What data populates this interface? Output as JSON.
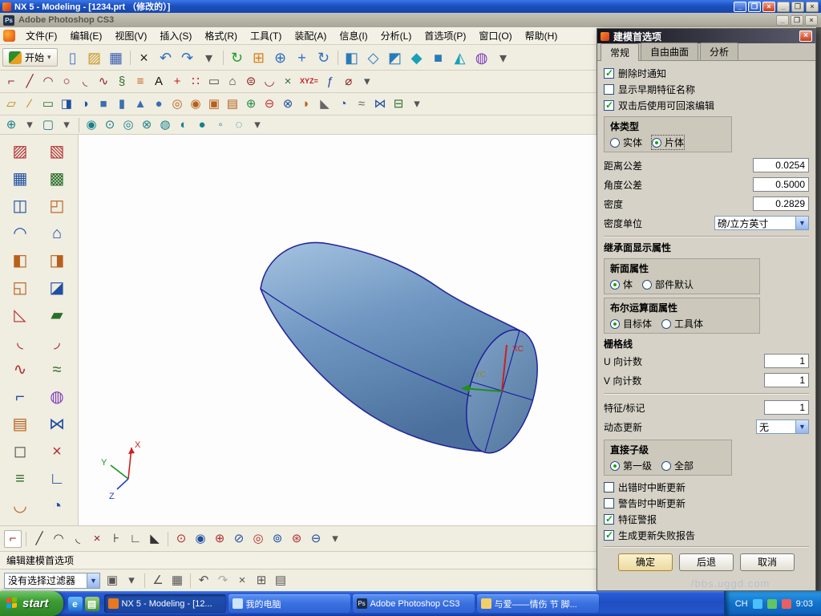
{
  "titlebar": {
    "title": "NX 5 - Modeling - [1234.prt （修改的）]"
  },
  "photoshop": {
    "title": "Adobe Photoshop CS3"
  },
  "menu": [
    "文件(F)",
    "编辑(E)",
    "视图(V)",
    "插入(S)",
    "格式(R)",
    "工具(T)",
    "装配(A)",
    "信息(I)",
    "分析(L)",
    "首选项(P)",
    "窗口(O)",
    "帮助(H)"
  ],
  "start_button": {
    "label": "开始",
    "arrow": "▾"
  },
  "icons": {
    "row1": [
      {
        "name": "new-part-icon",
        "glyph": "▯",
        "color": "#4a76c8"
      },
      {
        "name": "open-icon",
        "glyph": "▨",
        "color": "#c8982a"
      },
      {
        "name": "save-icon",
        "glyph": "▦",
        "color": "#3a5fae"
      },
      {
        "sep": true
      },
      {
        "name": "delete-icon",
        "glyph": "×",
        "color": "#222222"
      },
      {
        "name": "undo-icon",
        "glyph": "↶",
        "color": "#2d6fc2"
      },
      {
        "name": "redo-icon",
        "glyph": "↷",
        "color": "#2d6fc2"
      },
      {
        "name": "dropdown-icon",
        "glyph": "▾",
        "color": "#555555"
      },
      {
        "sep": true
      },
      {
        "name": "refresh-icon",
        "glyph": "↻",
        "color": "#1f9d2f"
      },
      {
        "name": "fit-view-icon",
        "glyph": "⊞",
        "color": "#d9821e"
      },
      {
        "name": "zoom-icon",
        "glyph": "⊕",
        "color": "#2d6fc2"
      },
      {
        "name": "pan-icon",
        "glyph": "+",
        "color": "#2d6fc2"
      },
      {
        "name": "rotate-view-icon",
        "glyph": "↻",
        "color": "#2d6fc2"
      },
      {
        "sep": true
      },
      {
        "name": "shaded-view-icon",
        "glyph": "◧",
        "color": "#2a7ab8"
      },
      {
        "name": "wireframe-view-icon",
        "glyph": "◇",
        "color": "#2a7ab8"
      },
      {
        "name": "trimetric-view-icon",
        "glyph": "◩",
        "color": "#2a7ab8"
      },
      {
        "name": "isometric-view-icon",
        "glyph": "◆",
        "color": "#18a0b8"
      },
      {
        "name": "front-view-icon",
        "glyph": "■",
        "color": "#2a7ab8"
      },
      {
        "name": "orient-view-icon",
        "glyph": "◭",
        "color": "#18a0b8"
      },
      {
        "name": "display-mode-icon",
        "glyph": "◍",
        "color": "#7a3ab8"
      },
      {
        "name": "dropdown-icon",
        "glyph": "▾",
        "color": "#555555"
      }
    ],
    "row2": [
      {
        "name": "profile-icon",
        "glyph": "⌐",
        "color": "#8a1f1f"
      },
      {
        "name": "line-icon",
        "glyph": "╱",
        "color": "#8a1f1f"
      },
      {
        "name": "arc-icon",
        "glyph": "◠",
        "color": "#8a1f1f"
      },
      {
        "name": "circle-icon",
        "glyph": "○",
        "color": "#8a1f1f"
      },
      {
        "name": "fillet-curve-icon",
        "glyph": "◟",
        "color": "#8a1f1f"
      },
      {
        "name": "spline-icon",
        "glyph": "∿",
        "color": "#8a1f1f"
      },
      {
        "name": "helix-icon",
        "glyph": "§",
        "color": "#2a6f2a"
      },
      {
        "name": "offset-curve-icon",
        "glyph": "≡",
        "color": "#c2641e"
      },
      {
        "name": "text-icon",
        "glyph": "A",
        "color": "#111111"
      },
      {
        "name": "point-icon",
        "glyph": "+",
        "color": "#c02020"
      },
      {
        "name": "point-set-icon",
        "glyph": "∷",
        "color": "#c02020"
      },
      {
        "name": "rectangle-icon",
        "glyph": "▭",
        "color": "#444444"
      },
      {
        "name": "polygon-icon",
        "glyph": "⌂",
        "color": "#444444"
      },
      {
        "name": "ellipse-icon",
        "glyph": "⊜",
        "color": "#8a1f1f"
      },
      {
        "name": "conic-icon",
        "glyph": "◡",
        "color": "#8a1f1f"
      },
      {
        "name": "intersection-point-icon",
        "glyph": "×",
        "color": "#2a6f2a"
      },
      {
        "name": "coordinates-icon",
        "glyph": "XYZ=",
        "color": "#c02020",
        "wide": true
      },
      {
        "name": "law-curve-icon",
        "glyph": "ƒ",
        "color": "#1f4fa0"
      },
      {
        "name": "group-curve-icon",
        "glyph": "⌀",
        "color": "#8a1f1f"
      },
      {
        "name": "dropdown-icon",
        "glyph": "▾",
        "color": "#555555"
      }
    ],
    "row3": [
      {
        "name": "datum-plane-icon",
        "glyph": "▱",
        "color": "#b8860b"
      },
      {
        "name": "datum-axis-icon",
        "glyph": "∕",
        "color": "#b8860b"
      },
      {
        "name": "sketch-icon",
        "glyph": "▭",
        "color": "#2a6f2a"
      },
      {
        "name": "extrude-icon",
        "glyph": "◨",
        "color": "#1f4fa0"
      },
      {
        "name": "revolve-icon",
        "glyph": "◑",
        "color": "#1f4fa0"
      },
      {
        "name": "block-icon",
        "glyph": "■",
        "color": "#3a6fb0"
      },
      {
        "name": "cylinder-icon",
        "glyph": "▮",
        "color": "#3a6fb0"
      },
      {
        "name": "cone-icon",
        "glyph": "▲",
        "color": "#3a6fb0"
      },
      {
        "name": "sphere-primitive-icon",
        "glyph": "●",
        "color": "#3a6fb0"
      },
      {
        "name": "hole-icon",
        "glyph": "◎",
        "color": "#b8601a"
      },
      {
        "name": "boss-icon",
        "glyph": "◉",
        "color": "#b8601a"
      },
      {
        "name": "pocket-icon",
        "glyph": "▣",
        "color": "#b8601a"
      },
      {
        "name": "pad-icon",
        "glyph": "▤",
        "color": "#b8601a"
      },
      {
        "name": "unite-icon",
        "glyph": "⊕",
        "color": "#1f8f3f"
      },
      {
        "name": "subtract-icon",
        "glyph": "⊖",
        "color": "#c03030"
      },
      {
        "name": "intersect-icon",
        "glyph": "⊗",
        "color": "#1f4fa0"
      },
      {
        "name": "edge-blend-icon",
        "glyph": "◗",
        "color": "#b8601a"
      },
      {
        "name": "chamfer-icon",
        "glyph": "◣",
        "color": "#666666"
      },
      {
        "name": "shell-icon",
        "glyph": "◔",
        "color": "#1f4fa0"
      },
      {
        "name": "thread-icon",
        "glyph": "≈",
        "color": "#666666"
      },
      {
        "name": "sew-icon",
        "glyph": "⋈",
        "color": "#1f4fa0"
      },
      {
        "name": "thicken-icon",
        "glyph": "⊟",
        "color": "#2a6f2a"
      },
      {
        "name": "dropdown-icon",
        "glyph": "▾",
        "color": "#555555"
      }
    ],
    "row4": [
      {
        "name": "point-dialog-icon",
        "glyph": "⊕",
        "color": "#18808a"
      },
      {
        "name": "dropdown-icon",
        "glyph": "▾",
        "color": "#555555"
      },
      {
        "name": "plane-dialog-icon",
        "glyph": "▢",
        "color": "#18808a"
      },
      {
        "name": "dropdown-icon",
        "glyph": "▾",
        "color": "#555555"
      },
      {
        "sep": true
      },
      {
        "name": "snap-endpoint-icon",
        "glyph": "◉",
        "color": "#18808a"
      },
      {
        "name": "snap-midpoint-icon",
        "glyph": "⊙",
        "color": "#18808a"
      },
      {
        "name": "snap-control-point-icon",
        "glyph": "◎",
        "color": "#18808a"
      },
      {
        "name": "snap-intersection-icon",
        "glyph": "⊗",
        "color": "#18808a"
      },
      {
        "name": "snap-center-icon",
        "glyph": "◍",
        "color": "#18808a"
      },
      {
        "name": "snap-quadrant-icon",
        "glyph": "◐",
        "color": "#18808a"
      },
      {
        "name": "snap-existing-point-icon",
        "glyph": "●",
        "color": "#18808a"
      },
      {
        "name": "snap-point-on-curve-icon",
        "glyph": "◦",
        "color": "#18808a"
      },
      {
        "name": "snap-point-on-surface-icon",
        "glyph": "◌",
        "color": "#18808a"
      },
      {
        "name": "dropdown-icon",
        "glyph": "▾",
        "color": "#555555"
      }
    ],
    "sidebar": [
      {
        "name": "through-points-icon",
        "glyph": "▨",
        "color": "#b03030"
      },
      {
        "name": "ruled-surface-icon",
        "glyph": "▧",
        "color": "#b03030"
      },
      {
        "name": "through-curves-icon",
        "glyph": "▦",
        "color": "#1f4fa0"
      },
      {
        "name": "through-curve-mesh-icon",
        "glyph": "▩",
        "color": "#2a6f2a"
      },
      {
        "name": "swept-surface-icon",
        "glyph": "◫",
        "color": "#1f4fa0"
      },
      {
        "name": "section-surface-icon",
        "glyph": "◰",
        "color": "#b8601a"
      },
      {
        "name": "bridge-surface-icon",
        "glyph": "◠",
        "color": "#1f4fa0"
      },
      {
        "name": "n-sided-surface-icon",
        "glyph": "⌂",
        "color": "#1f4fa0"
      },
      {
        "name": "extension-surface-icon",
        "glyph": "◧",
        "color": "#b8601a"
      },
      {
        "name": "law-extension-icon",
        "glyph": "◨",
        "color": "#b8601a"
      },
      {
        "name": "enlarge-surface-icon",
        "glyph": "◱",
        "color": "#b8601a"
      },
      {
        "name": "offset-surface-icon",
        "glyph": "◪",
        "color": "#1f4fa0"
      },
      {
        "name": "trimmed-sheet-icon",
        "glyph": "◺",
        "color": "#b03030"
      },
      {
        "name": "bounded-plane-icon",
        "glyph": "▰",
        "color": "#2a6f2a"
      },
      {
        "name": "fillet-surface-icon",
        "glyph": "◟",
        "color": "#b03030"
      },
      {
        "name": "face-blend-icon",
        "glyph": "◞",
        "color": "#b03030"
      },
      {
        "name": "soft-blend-icon",
        "glyph": "∿",
        "color": "#b03030"
      },
      {
        "name": "styled-blend-icon",
        "glyph": "≈",
        "color": "#2a6f2a"
      },
      {
        "name": "silhouette-flange-icon",
        "glyph": "⌐",
        "color": "#1f4fa0"
      },
      {
        "name": "global-shaping-icon",
        "glyph": "◍",
        "color": "#7a3ab8"
      },
      {
        "name": "quilt-surface-icon",
        "glyph": "▤",
        "color": "#b8601a"
      },
      {
        "name": "sew-surface-icon",
        "glyph": "⋈",
        "color": "#1f4fa0"
      },
      {
        "name": "untrim-icon",
        "glyph": "◻",
        "color": "#555555"
      },
      {
        "name": "x-form-icon",
        "glyph": "×",
        "color": "#b03030"
      },
      {
        "name": "i-form-icon",
        "glyph": "≡",
        "color": "#2a6f2a"
      },
      {
        "name": "match-edge-icon",
        "glyph": "∟",
        "color": "#1f4fa0"
      },
      {
        "name": "developed-surface-icon",
        "glyph": "◡",
        "color": "#b8601a"
      },
      {
        "name": "surface-analysis-icon",
        "glyph": "◔",
        "color": "#1f4fa0"
      }
    ],
    "bottom": [
      {
        "name": "sketch-profile-icon",
        "glyph": "⌐",
        "color": "#8a1f1f",
        "bg": "#ffffff"
      },
      {
        "sep": true
      },
      {
        "name": "sketch-line-icon",
        "glyph": "╱",
        "color": "#333333"
      },
      {
        "name": "sketch-arc-icon",
        "glyph": "◠",
        "color": "#333333"
      },
      {
        "name": "sketch-fillet-icon",
        "glyph": "◟",
        "color": "#333333"
      },
      {
        "name": "quick-trim-icon",
        "glyph": "×",
        "color": "#8a1f1f"
      },
      {
        "name": "quick-extend-icon",
        "glyph": "⊦",
        "color": "#333333"
      },
      {
        "name": "sketch-corner-icon",
        "glyph": "∟",
        "color": "#333333"
      },
      {
        "name": "sketch-chamfer-icon",
        "glyph": "◣",
        "color": "#333333"
      },
      {
        "sep": true
      },
      {
        "name": "constraint-icon-1",
        "glyph": "⊙",
        "color": "#b03030"
      },
      {
        "name": "constraint-icon-2",
        "glyph": "◉",
        "color": "#1f4fa0"
      },
      {
        "name": "constraint-icon-3",
        "glyph": "⊕",
        "color": "#b03030"
      },
      {
        "name": "constraint-icon-4",
        "glyph": "⊘",
        "color": "#1f4fa0"
      },
      {
        "name": "constraint-icon-5",
        "glyph": "◎",
        "color": "#b03030"
      },
      {
        "name": "constraint-icon-6",
        "glyph": "⊚",
        "color": "#1f4fa0"
      },
      {
        "name": "constraint-icon-7",
        "glyph": "⊛",
        "color": "#b03030"
      },
      {
        "name": "constraint-icon-8",
        "glyph": "⊖",
        "color": "#1f4fa0"
      },
      {
        "name": "dropdown-icon",
        "glyph": "▾",
        "color": "#555555"
      }
    ],
    "selbar": [
      {
        "name": "filter-type-icon",
        "glyph": "▣",
        "color": "#555555"
      },
      {
        "name": "dropdown-icon",
        "glyph": "▾",
        "color": "#555555"
      },
      {
        "sep": true
      },
      {
        "name": "snap-toggle-icon",
        "glyph": "∠",
        "color": "#555555"
      },
      {
        "name": "grid-toggle-icon",
        "glyph": "▦",
        "color": "#555555"
      },
      {
        "sep": true
      },
      {
        "name": "undo-small-icon",
        "glyph": "↶",
        "color": "#555555"
      },
      {
        "name": "redo-small-icon",
        "glyph": "↷",
        "color": "#aaaaaa"
      },
      {
        "name": "cut-small-icon",
        "glyph": "×",
        "color": "#555555"
      },
      {
        "name": "copy-small-icon",
        "glyph": "⊞",
        "color": "#555555"
      },
      {
        "name": "paste-small-icon",
        "glyph": "▤",
        "color": "#555555"
      }
    ]
  },
  "viewport": {
    "labels": {
      "xc": "XC",
      "yc": "YC",
      "x": "X",
      "y": "Y",
      "z": "Z"
    }
  },
  "dialog": {
    "title": "建模首选项",
    "tabs": [
      "常规",
      "自由曲面",
      "分析"
    ],
    "checks_top": [
      {
        "label": "删除时通知",
        "on": true
      },
      {
        "label": "显示早期特征名称",
        "on": false
      },
      {
        "label": "双击后使用可回滚编辑",
        "on": true
      }
    ],
    "body_type": {
      "title": "体类型",
      "options": [
        {
          "label": "实体",
          "on": false
        },
        {
          "label": "片体",
          "on": true
        }
      ]
    },
    "fields": {
      "distance": {
        "label": "距离公差",
        "value": "0.0254"
      },
      "angle": {
        "label": "角度公差",
        "value": "0.5000"
      },
      "density": {
        "label": "密度",
        "value": "0.2829"
      },
      "density_unit": {
        "label": "密度单位",
        "value": "磅/立方英寸"
      }
    },
    "inherit_header": "继承面显示属性",
    "new_face": {
      "title": "新面属性",
      "options": [
        {
          "label": "体",
          "on": true
        },
        {
          "label": "部件默认",
          "on": false
        }
      ]
    },
    "bool_face": {
      "title": "布尔运算面属性",
      "options": [
        {
          "label": "目标体",
          "on": true
        },
        {
          "label": "工具体",
          "on": false
        }
      ]
    },
    "grid_header": "栅格线",
    "u_count": {
      "label": "U 向计数",
      "value": "1"
    },
    "v_count": {
      "label": "V 向计数",
      "value": "1"
    },
    "feature_tag": {
      "label": "特征/标记",
      "value": "1"
    },
    "dynamic_update": {
      "label": "动态更新",
      "value": "无"
    },
    "direct_child": {
      "title": "直接子级",
      "options": [
        {
          "label": "第一级",
          "on": true
        },
        {
          "label": "全部",
          "on": false
        }
      ]
    },
    "checks_bottom": [
      {
        "label": "出错时中断更新",
        "on": false
      },
      {
        "label": "警告时中断更新",
        "on": false
      },
      {
        "label": "特征警报",
        "on": true
      },
      {
        "label": "生成更新失败报告",
        "on": true
      }
    ],
    "buttons": {
      "ok": "确定",
      "back": "后退",
      "cancel": "取消"
    }
  },
  "status": {
    "prompt": "编辑建模首选项"
  },
  "selection_bar": {
    "filter": "没有选择过滤器"
  },
  "taskbar": {
    "start": "start",
    "tasks": [
      {
        "label": "NX 5 - Modeling - [12...",
        "active": true,
        "icon_color": "#e87820",
        "icon_text": ""
      },
      {
        "label": "我的电脑",
        "active": false,
        "icon_color": "#cde4ff",
        "icon_text": ""
      },
      {
        "label": "Adobe Photoshop CS3",
        "active": false,
        "icon_color": "#1c2b4a",
        "icon_text": "Ps"
      },
      {
        "label": "与爱——情伤 节 脚...",
        "active": false,
        "icon_color": "#f3cf6a",
        "icon_text": ""
      }
    ],
    "tray": {
      "lang": "CH",
      "time": "9:03"
    }
  },
  "watermark": "/bbs.uggd.com",
  "colors": {
    "accent": "#2a67da",
    "taskbar_blue": "#2456cc",
    "start_green": "#3d9c34",
    "dialog_bg": "#d6d2c8",
    "model_blue": "#6f95c0",
    "edge_navy": "#1a1a9c"
  }
}
